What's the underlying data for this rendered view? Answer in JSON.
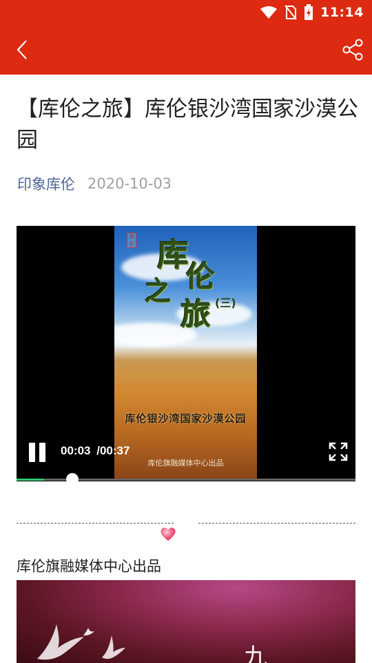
{
  "status_bar": {
    "time": "11:14",
    "icons": [
      "wifi-icon",
      "no-sim-icon",
      "battery-charging-icon"
    ]
  },
  "header": {
    "back_icon": "back-chevron-icon",
    "share_icon": "share-icon",
    "bg_color": "#dd2a10"
  },
  "article": {
    "title": "【库伦之旅】库伦银沙湾国家沙漠公园",
    "author": "印象库伦",
    "date": "2020-10-03"
  },
  "video": {
    "poster_title_chars": [
      "库",
      "伦",
      "之",
      "旅"
    ],
    "poster_title_suffix": "(三)",
    "poster_subtitle": "库伦银沙湾国家沙漠公园",
    "poster_credit": "库伦旗融媒体中心出品",
    "poster_logo": "库伦",
    "current_time": "00:03",
    "duration": "/00:37",
    "progress_fraction": 0.081,
    "progress_color": "#2ecc71"
  },
  "body": {
    "caption": "库伦旗融媒体中心出品",
    "image2_char": "九"
  }
}
